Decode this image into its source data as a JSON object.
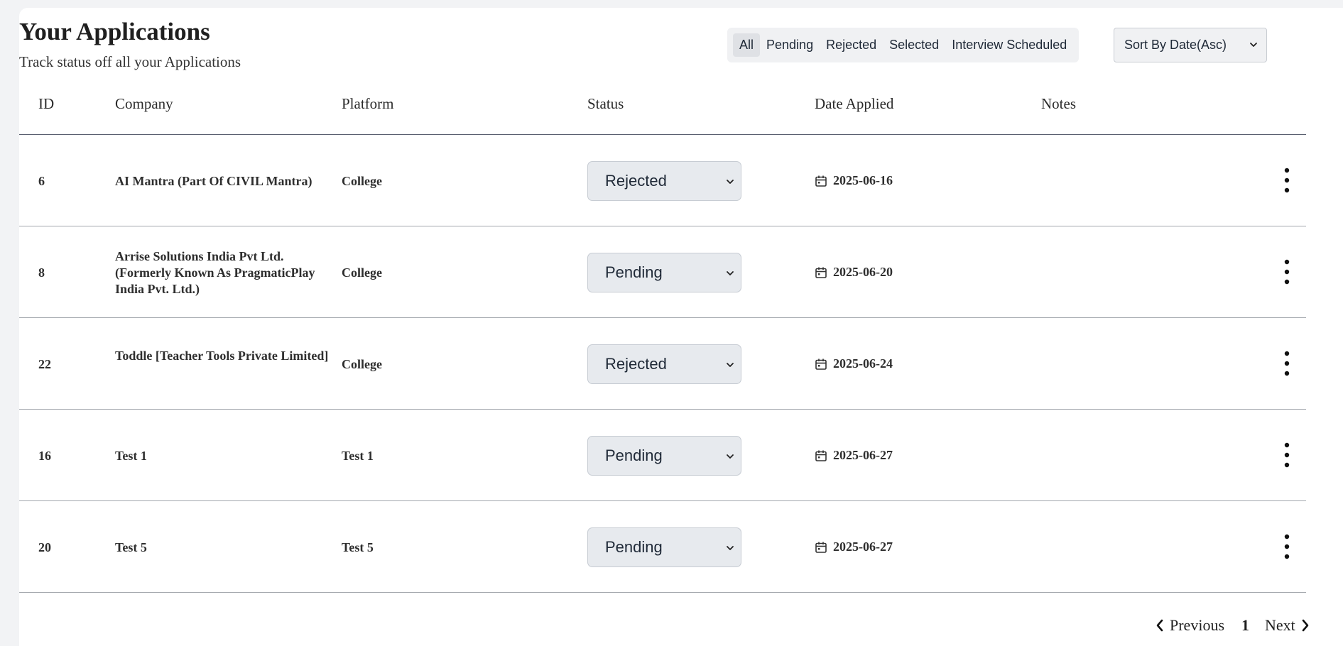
{
  "header": {
    "title": "Your Applications",
    "subtitle": "Track status off all your Applications"
  },
  "filters": {
    "tabs": [
      "All",
      "Pending",
      "Rejected",
      "Selected",
      "Interview Scheduled"
    ],
    "active": "All"
  },
  "sort": {
    "selected": "Sort By Date(Asc)"
  },
  "table": {
    "columns": [
      "ID",
      "Company",
      "Platform",
      "Status",
      "Date Applied",
      "Notes"
    ],
    "rows": [
      {
        "id": "6",
        "company": "AI Mantra (Part Of CIVIL Mantra)",
        "platform": "College",
        "status": "Rejected",
        "date": "2025-06-16",
        "notes": ""
      },
      {
        "id": "8",
        "company": "Arrise Solutions India Pvt Ltd. (Formerly Known As PragmaticPlay India Pvt. Ltd.)",
        "platform": "College",
        "status": "Pending",
        "date": "2025-06-20",
        "notes": ""
      },
      {
        "id": "22",
        "company": "Toddle [Teacher Tools Private Limited]",
        "platform": "College",
        "status": "Rejected",
        "date": "2025-06-24",
        "notes": ""
      },
      {
        "id": "16",
        "company": "Test 1",
        "platform": "Test 1",
        "status": "Pending",
        "date": "2025-06-27",
        "notes": ""
      },
      {
        "id": "20",
        "company": "Test 5",
        "platform": "Test 5",
        "status": "Pending",
        "date": "2025-06-27",
        "notes": ""
      }
    ]
  },
  "pagination": {
    "previous_label": "Previous",
    "current_page": "1",
    "next_label": "Next"
  },
  "icons": {
    "row_date": "calendar-icon",
    "row_menu": "kebab-menu-icon",
    "select_arrow": "chevron-down-icon",
    "prev": "chevron-left-icon",
    "next": "chevron-right-icon"
  }
}
